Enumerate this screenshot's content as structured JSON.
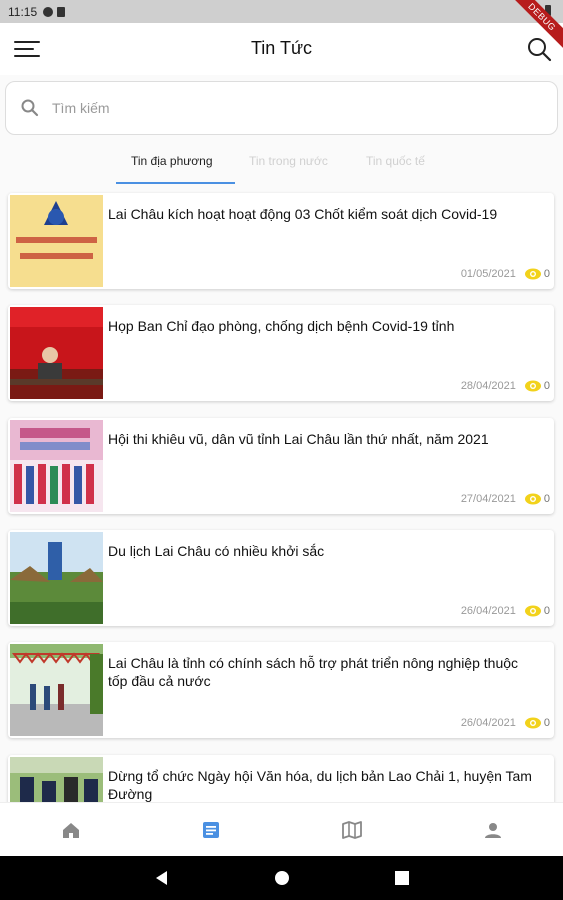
{
  "status": {
    "time": "11:15"
  },
  "debug_label": "DEBUG",
  "app_bar": {
    "title": "Tin Tức"
  },
  "search": {
    "placeholder": "Tìm kiếm"
  },
  "tabs": [
    {
      "label": "Tin địa phương",
      "active": true
    },
    {
      "label": "Tin trong nước",
      "active": false
    },
    {
      "label": "Tin quốc tế",
      "active": false
    }
  ],
  "articles": [
    {
      "title": "Lai Châu kích hoạt hoạt động 03 Chốt kiểm soát dịch Covid-19",
      "date": "01/05/2021",
      "views": "0"
    },
    {
      "title": "Họp Ban Chỉ đạo phòng, chống dịch bệnh Covid-19 tỉnh",
      "date": "28/04/2021",
      "views": "0"
    },
    {
      "title": "Hội thi khiêu vũ, dân vũ tỉnh Lai Châu lần thứ nhất, năm 2021",
      "date": "27/04/2021",
      "views": "0"
    },
    {
      "title": "Du lịch Lai Châu có nhiều khởi sắc",
      "date": "26/04/2021",
      "views": "0"
    },
    {
      "title": "Lai Châu là tỉnh có chính sách hỗ trợ phát triển nông nghiệp thuộc tốp đầu cả nước",
      "date": "26/04/2021",
      "views": "0"
    },
    {
      "title": "Dừng tổ chức Ngày hội Văn hóa, du lịch bản Lao Chải 1, huyện Tam Đường",
      "date": "",
      "views": ""
    }
  ],
  "bottom_nav": [
    {
      "icon": "home-icon",
      "active": false
    },
    {
      "icon": "article-icon",
      "active": true
    },
    {
      "icon": "map-icon",
      "active": false
    },
    {
      "icon": "person-icon",
      "active": false
    }
  ],
  "colors": {
    "accent": "#4a90e2",
    "eye": "#f2d21b",
    "inactive_tab": "#d0d0d0"
  }
}
